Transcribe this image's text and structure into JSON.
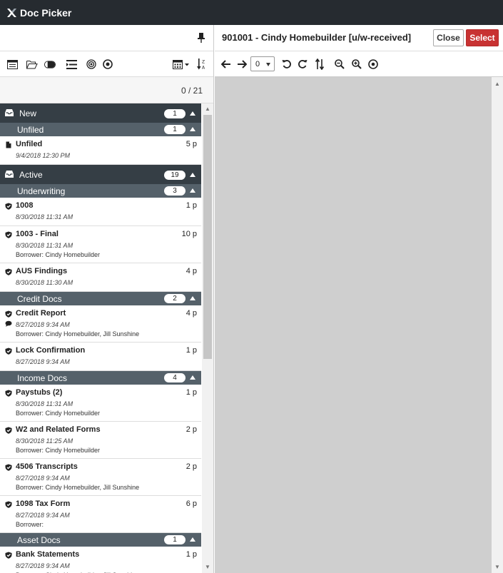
{
  "app": {
    "title": "Doc Picker"
  },
  "left": {
    "count_text": "0 / 21",
    "groups": [
      {
        "label": "New",
        "count": "1",
        "subgroups": [
          {
            "label": "Unfiled",
            "count": "1",
            "items": [
              {
                "name": "Unfiled",
                "pages": "5 p",
                "date": "9/4/2018 12:30 PM",
                "borrower": ""
              }
            ]
          }
        ]
      },
      {
        "label": "Active",
        "count": "19",
        "subgroups": [
          {
            "label": "Underwriting",
            "count": "3",
            "items": [
              {
                "name": "1008",
                "pages": "1 p",
                "date": "8/30/2018 11:31 AM",
                "borrower": ""
              },
              {
                "name": "1003 - Final",
                "pages": "10 p",
                "date": "8/30/2018 11:31 AM",
                "borrower": "Borrower:  Cindy Homebuilder"
              },
              {
                "name": "AUS Findings",
                "pages": "4 p",
                "date": "8/30/2018 11:30 AM",
                "borrower": ""
              }
            ]
          },
          {
            "label": "Credit Docs",
            "count": "2",
            "items": [
              {
                "name": "Credit Report",
                "pages": "4 p",
                "date": "8/27/2018 9:34 AM",
                "borrower": "Borrower:  Cindy Homebuilder, Jill Sunshine"
              },
              {
                "name": "Lock Confirmation",
                "pages": "1 p",
                "date": "8/27/2018 9:34 AM",
                "borrower": ""
              }
            ]
          },
          {
            "label": "Income Docs",
            "count": "4",
            "items": [
              {
                "name": "Paystubs (2)",
                "pages": "1 p",
                "date": "8/30/2018 11:31 AM",
                "borrower": "Borrower:  Cindy Homebuilder"
              },
              {
                "name": "W2 and Related Forms",
                "pages": "2 p",
                "date": "8/30/2018 11:25 AM",
                "borrower": "Borrower:  Cindy Homebuilder"
              },
              {
                "name": "4506 Transcripts",
                "pages": "2 p",
                "date": "8/27/2018 9:34 AM",
                "borrower": "Borrower:  Cindy Homebuilder, Jill Sunshine"
              },
              {
                "name": "1098 Tax Form",
                "pages": "6 p",
                "date": "8/27/2018 9:34 AM",
                "borrower": "Borrower:"
              }
            ]
          },
          {
            "label": "Asset Docs",
            "count": "1",
            "items": [
              {
                "name": "Bank Statements",
                "pages": "1 p",
                "date": "8/27/2018 9:34 AM",
                "borrower": "Borrower:  Cindy Homebuilder, Jill Sunshine"
              }
            ]
          }
        ]
      }
    ]
  },
  "right": {
    "doc_title": "901001 - Cindy Homebuilder [u/w-received]",
    "close_label": "Close",
    "select_label": "Select",
    "page_value": "0"
  },
  "colors": {
    "titlebar": "#262b30",
    "group": "#353e45",
    "subgroup": "#55616a",
    "select": "#c83232",
    "viewer": "#cfcfcf"
  }
}
